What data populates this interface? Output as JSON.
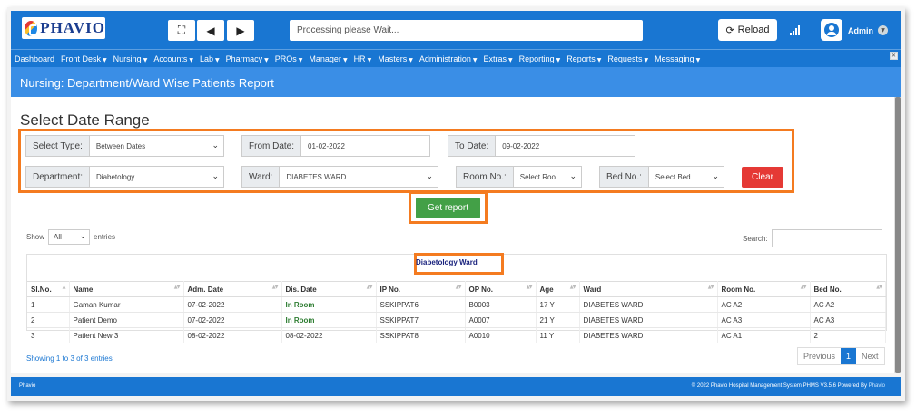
{
  "app": {
    "logo_text": "PHAVIO",
    "processing": "Processing please Wait...",
    "reload_label": "Reload",
    "user": "Admin"
  },
  "menu": [
    "Dashboard",
    "Front Desk",
    "Nursing",
    "Accounts",
    "Lab",
    "Pharmacy",
    "PROs",
    "Manager",
    "HR",
    "Masters",
    "Administration",
    "Extras",
    "Reporting",
    "Reports",
    "Requests",
    "Messaging"
  ],
  "page_title": "Nursing: Department/Ward Wise Patients Report",
  "section_title": "Select Date Range",
  "filters": {
    "select_type": {
      "label": "Select Type:",
      "value": "Between Dates"
    },
    "from_date": {
      "label": "From Date:",
      "value": "01-02-2022"
    },
    "to_date": {
      "label": "To Date:",
      "value": "09-02-2022"
    },
    "department": {
      "label": "Department:",
      "value": "Diabetology"
    },
    "ward": {
      "label": "Ward:",
      "value": "DIABETES WARD"
    },
    "room": {
      "label": "Room No.:",
      "value": "Select Roo"
    },
    "bed": {
      "label": "Bed No.:",
      "value": "Select Bed"
    },
    "clear_label": "Clear",
    "report_label": "Get report"
  },
  "table_controls": {
    "show": "Show",
    "show_value": "All",
    "entries": "entries",
    "search": "Search:"
  },
  "ward_caption": "Diabetology Ward",
  "columns": [
    "Sl.No.",
    "Name",
    "Adm. Date",
    "Dis. Date",
    "IP No.",
    "OP No.",
    "Age",
    "Ward",
    "Room No.",
    "Bed No."
  ],
  "rows": [
    [
      "1",
      "Gaman Kumar",
      "07-02-2022",
      "In Room",
      "SSKIPPAT6",
      "B0003",
      "17 Y",
      "DIABETES WARD",
      "AC A2",
      "AC A2"
    ],
    [
      "2",
      "Patient Demo",
      "07-02-2022",
      "In Room",
      "SSKIPPAT7",
      "A0007",
      "21 Y",
      "DIABETES WARD",
      "AC A3",
      "AC A3"
    ],
    [
      "3",
      "Patient New 3",
      "08-02-2022",
      "08-02-2022",
      "SSKIPPAT8",
      "A0010",
      "11 Y",
      "DIABETES WARD",
      "AC A1",
      "2"
    ]
  ],
  "showing": "Showing 1 to 3 of 3 entries",
  "pager": {
    "previous": "Previous",
    "page": "1",
    "next": "Next"
  },
  "footer": {
    "left": "Phavio",
    "right": "© 2022 Phavio Hospital Management System PHMS V3.5.6 Powered By ",
    "brand": "Phavio"
  },
  "colors": {
    "primary": "#1976d2",
    "highlight": "#f47b20",
    "clear": "#e53935",
    "report": "#43a047"
  }
}
